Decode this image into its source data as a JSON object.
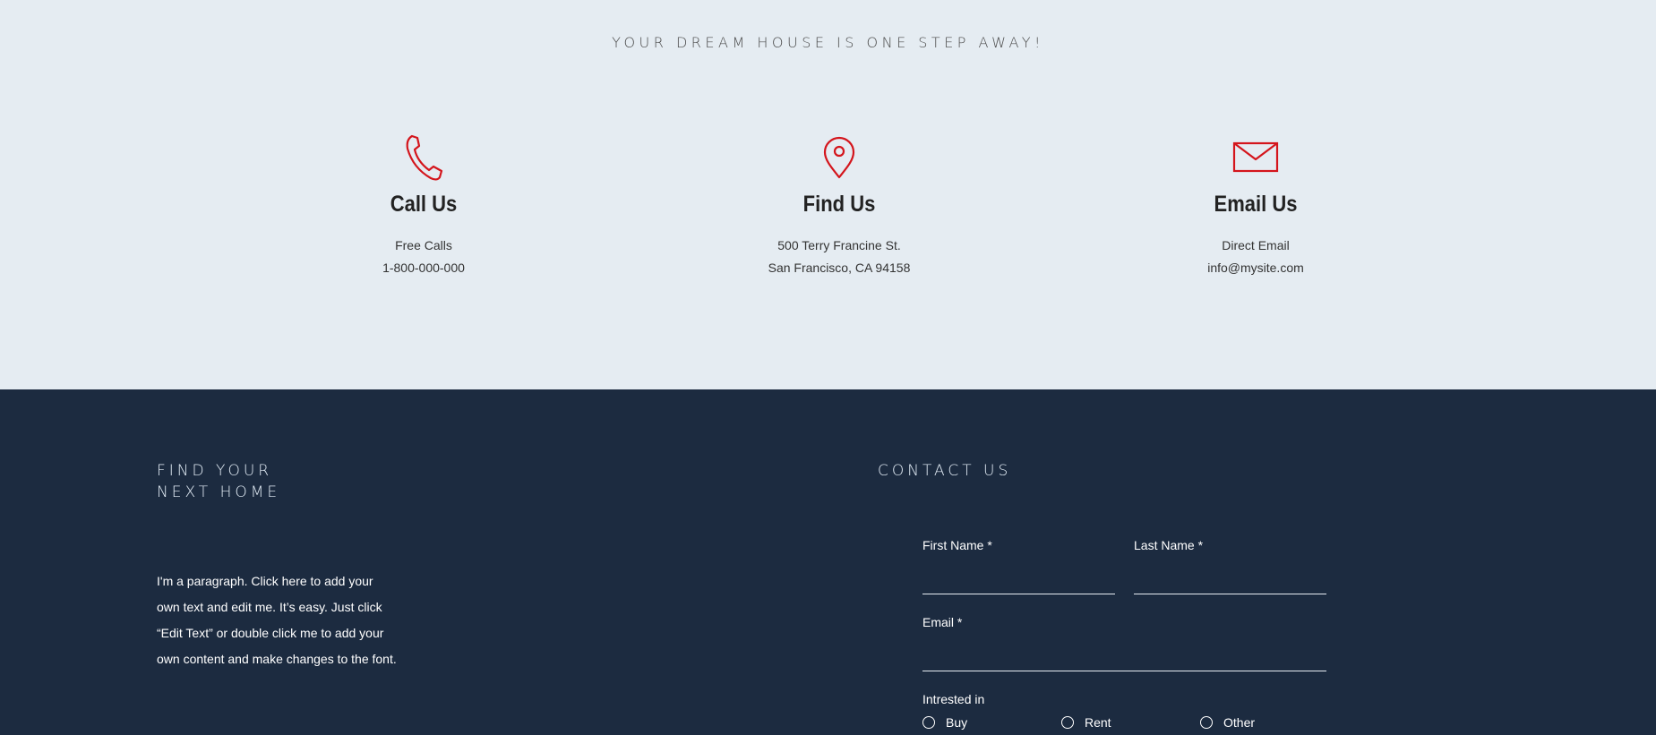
{
  "tagline": "YOUR DREAM HOUSE IS ONE STEP AWAY!",
  "contacts": [
    {
      "icon": "phone-icon",
      "title": "Call Us",
      "line1": "Free Calls",
      "line2": "1-800-000-000"
    },
    {
      "icon": "map-pin-icon",
      "title": "Find Us",
      "line1": "500 Terry Francine St.",
      "line2": "San Francisco, CA 94158"
    },
    {
      "icon": "envelope-icon",
      "title": "Email Us",
      "line1": "Direct Email",
      "line2": "info@mysite.com"
    }
  ],
  "colors": {
    "accent": "#d4151c",
    "top_bg": "#e5ecf2",
    "footer_bg": "#1c2b40"
  },
  "footer": {
    "left_title_1": "FIND YOUR",
    "left_title_2": "NEXT HOME",
    "paragraph": "I'm a paragraph. Click here to add your own text and edit me. It’s easy. Just click “Edit Text” or double click me to add your own content and make changes to the font.",
    "contact_title": "CONTACT US",
    "form": {
      "first_name_label": "First Name *",
      "last_name_label": "Last Name *",
      "email_label": "Email *",
      "interested_label": "Intrested in",
      "options": [
        "Buy",
        "Rent",
        "Other"
      ]
    }
  }
}
